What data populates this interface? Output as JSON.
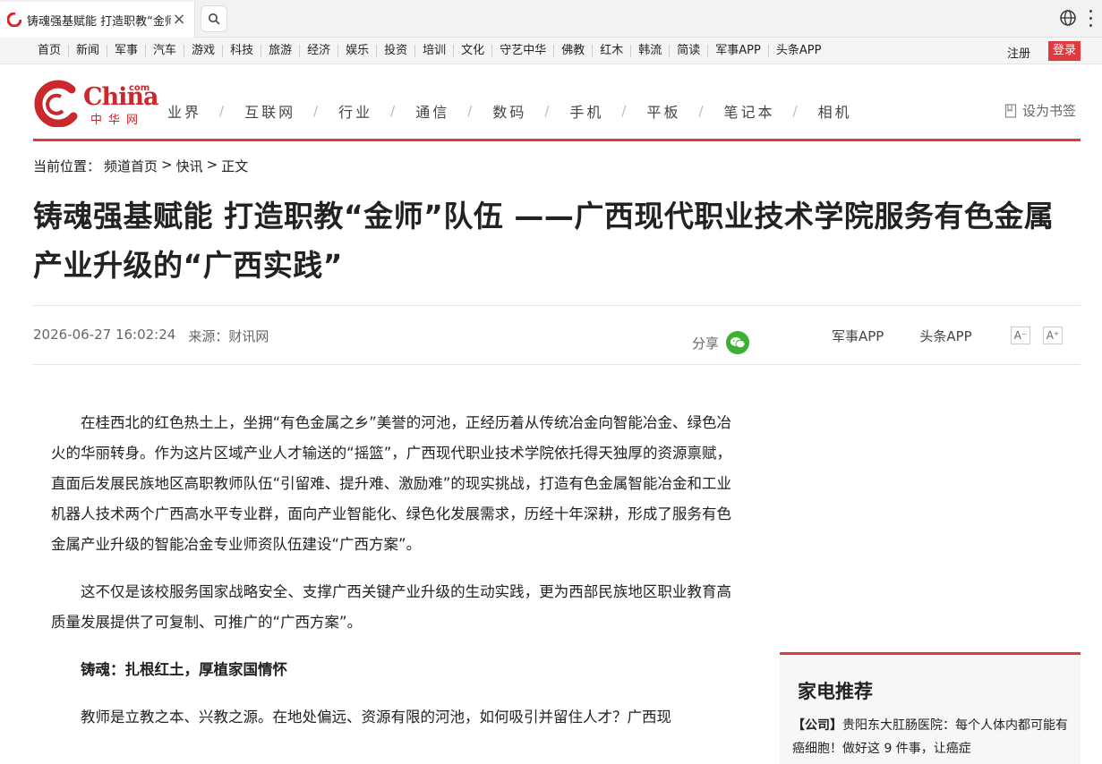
{
  "browser": {
    "tab_title": "铸魂强基赋能 打造职教“金师”队",
    "close_glyph": "×"
  },
  "topnav": {
    "items": [
      "首页",
      "新闻",
      "军事",
      "汽车",
      "游戏",
      "科技",
      "旅游",
      "经济",
      "娱乐",
      "投资",
      "培训",
      "文化",
      "守艺中华",
      "佛教",
      "红木",
      "韩流",
      "简读",
      "军事APP",
      "头条APP"
    ],
    "register": "注册",
    "login": "登录"
  },
  "header": {
    "logo_word": "China",
    "logo_com": "com",
    "logo_sub": "中华网",
    "nav": [
      "业界",
      "互联网",
      "行业",
      "通信",
      "数码",
      "手机",
      "平板",
      "笔记本",
      "相机"
    ],
    "nav_sep": "/",
    "bookmark": "设为书签"
  },
  "breadcrumb": {
    "label": "当前位置：",
    "items": [
      "频道首页",
      ">",
      "快讯",
      ">",
      "正文"
    ]
  },
  "article": {
    "title": "铸魂强基赋能 打造职教“金师”队伍 ——广西现代职业技术学院服务有色金属产业升级的“广西实践”",
    "date": "2026-06-27 16:02:24",
    "source": "来源：财讯网",
    "share": "分享",
    "app_links": [
      "军事APP",
      "头条APP"
    ],
    "font_smaller": "A⁻",
    "font_larger": "A⁺",
    "paragraphs": [
      "在桂西北的红色热土上，坐拥“有色金属之乡”美誉的河池，正经历着从传统冶金向智能冶金、绿色冶火的华丽转身。作为这片区域产业人才输送的“摇篮”，广西现代职业技术学院依托得天独厚的资源禀赋，直面后发展民族地区高职教师队伍“引留难、提升难、激励难”的现实挑战，打造有色金属智能冶金和工业机器人技术两个广西高水平专业群，面向产业智能化、绿色化发展需求，历经十年深耕，形成了服务有色金属产业升级的智能冶金专业师资队伍建设“广西方案”。",
      "这不仅是该校服务国家战略安全、支撑广西关键产业升级的生动实践，更为西部民族地区职业教育高质量发展提供了可复制、可推广的“广西方案”。"
    ],
    "subheading": "铸魂：扎根红土，厚植家国情怀",
    "paragraph_3": "教师是立教之本、兴教之源。在地处偏远、资源有限的河池，如何吸引并留住人才？广西现"
  },
  "sidebar": {
    "title": "家电推荐",
    "tag": "【公司】",
    "item_text": "贵阳东大肛肠医院：每个人体内都可能有癌细胞！做好这 9 件事，让癌症"
  },
  "colors": {
    "accent": "#e0393e",
    "logo_red": "#c9282d",
    "wechat_green": "#3cb034"
  }
}
